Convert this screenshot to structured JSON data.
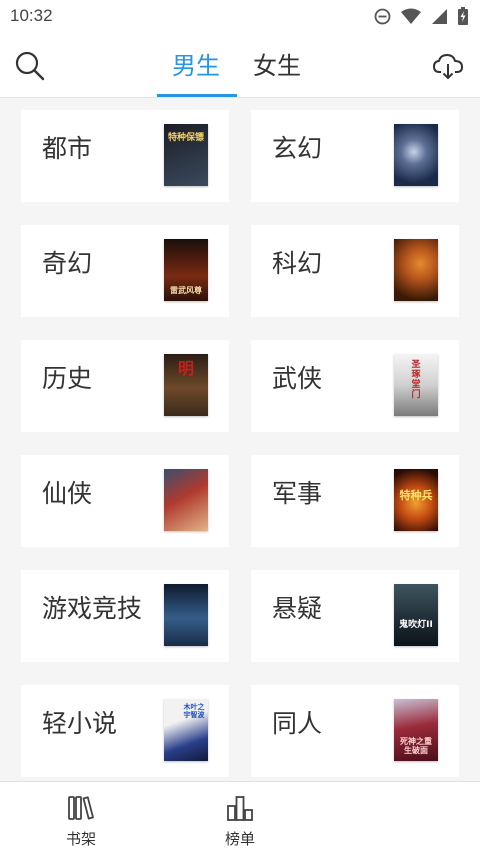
{
  "status_bar": {
    "time": "10:32"
  },
  "header": {
    "tabs": [
      {
        "label": "男生",
        "active": true
      },
      {
        "label": "女生",
        "active": false
      }
    ],
    "accent_color": "#2496e8",
    "icons": {
      "left": "search-icon",
      "right": "cloud-download-icon"
    }
  },
  "categories": [
    {
      "label": "都市",
      "cover": {
        "title": "特种保镖",
        "colors": [
          "#1a1d25",
          "#3b4a5e"
        ]
      }
    },
    {
      "label": "玄幻",
      "cover": {
        "title": "",
        "colors": [
          "#1b2a4a",
          "#5d6f96"
        ]
      }
    },
    {
      "label": "奇幻",
      "cover": {
        "title": "雷武风尊",
        "colors": [
          "#1a0f0a",
          "#7a2a12"
        ]
      }
    },
    {
      "label": "科幻",
      "cover": {
        "title": "",
        "colors": [
          "#3a1a06",
          "#b4541c"
        ]
      }
    },
    {
      "label": "历史",
      "cover": {
        "title": "明",
        "colors": [
          "#2a1e14",
          "#6e4a2a"
        ]
      }
    },
    {
      "label": "武侠",
      "cover": {
        "title": "圣琢堂门",
        "colors": [
          "#e9e9e9",
          "#9a9a9a"
        ]
      }
    },
    {
      "label": "仙侠",
      "cover": {
        "title": "",
        "colors": [
          "#b03a2e",
          "#3a4f6e"
        ]
      }
    },
    {
      "label": "军事",
      "cover": {
        "title": "特种兵",
        "colors": [
          "#2a0c06",
          "#c24a12"
        ]
      }
    },
    {
      "label": "游戏竞技",
      "cover": {
        "title": "",
        "colors": [
          "#0e1a2e",
          "#355e8a"
        ]
      }
    },
    {
      "label": "悬疑",
      "cover": {
        "title": "鬼吹灯ⅠⅠ",
        "colors": [
          "#0c1418",
          "#3e5560"
        ]
      }
    },
    {
      "label": "轻小说",
      "cover": {
        "title": "木叶之宇智波",
        "colors": [
          "#f2f2f2",
          "#2a3f8a"
        ]
      }
    },
    {
      "label": "同人",
      "cover": {
        "title": "死神之重生破面",
        "colors": [
          "#4a0e1a",
          "#9a2a3a"
        ]
      }
    }
  ],
  "bottom_nav": [
    {
      "label": "书架",
      "icon": "bookshelf-icon"
    },
    {
      "label": "榜单",
      "icon": "ranking-chart-icon"
    }
  ]
}
